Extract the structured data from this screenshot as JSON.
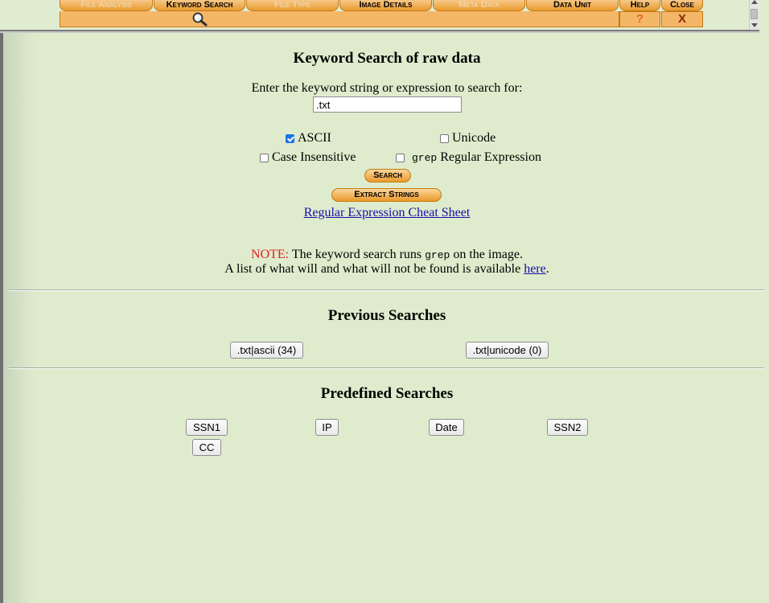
{
  "nav": {
    "tabs": [
      {
        "label": "File Analysis",
        "active": false
      },
      {
        "label": "Keyword Search",
        "active": true
      },
      {
        "label": "File Type",
        "active": false
      },
      {
        "label": "Image Details",
        "active": true
      },
      {
        "label": "Meta Data",
        "active": false
      },
      {
        "label": "Data Unit",
        "active": true
      },
      {
        "label": "Help",
        "active": true
      },
      {
        "label": "Close",
        "active": true
      }
    ],
    "help_symbol": "?",
    "close_symbol": "X",
    "search_icon": "magnifier-icon"
  },
  "page": {
    "title": "Keyword Search of raw data",
    "prompt": "Enter the keyword string or expression to search for:",
    "keyword_value": ".txt",
    "options": {
      "ascii": {
        "label": "ASCII",
        "checked": true
      },
      "unicode": {
        "label": "Unicode",
        "checked": false
      },
      "case_insensitive": {
        "label": "Case Insensitive",
        "checked": false
      },
      "grep_prefix": "grep",
      "regex": {
        "label": "Regular Expression",
        "checked": false
      }
    },
    "search_button": "Search",
    "extract_button": "Extract Strings",
    "cheat_sheet_link": "Regular Expression Cheat Sheet",
    "note_label": "NOTE:",
    "note_text_1": "The keyword search runs",
    "note_cmd": "grep",
    "note_text_2": "on the image.",
    "note_line2": "A list of what will and what will not be found is available",
    "note_link": "here",
    "note_period": "."
  },
  "previous": {
    "title": "Previous Searches",
    "items": [
      ".txt|ascii (34)",
      ".txt|unicode (0)"
    ]
  },
  "predefined": {
    "title": "Predefined Searches",
    "items": [
      "SSN1",
      "IP",
      "Date",
      "SSN2",
      "CC"
    ]
  },
  "colors": {
    "background": "#deeccd",
    "tab_orange": "#e99a2e",
    "note_red": "#e02020",
    "link_blue": "#1a0dab"
  }
}
